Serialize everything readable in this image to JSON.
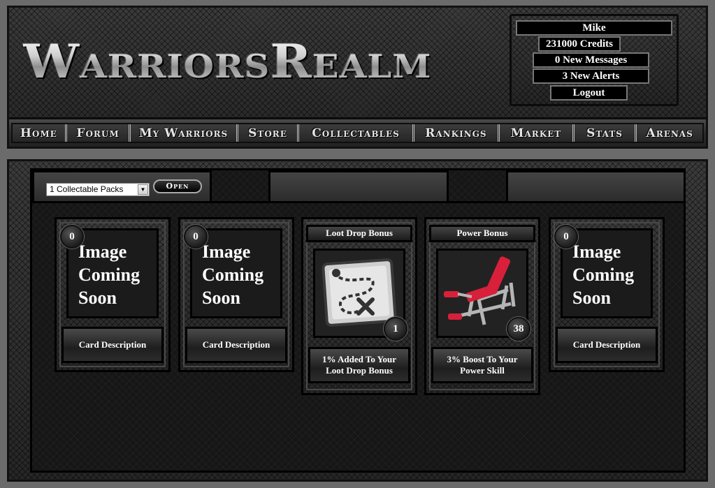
{
  "header": {
    "logo_text": "WarriorsRealm",
    "user": {
      "name": "Mike",
      "credits": "231000 Credits",
      "messages": "0 New Messages",
      "alerts": "3 New Alerts",
      "logout": "Logout"
    },
    "nav": [
      "Home",
      "Forum",
      "My Warriors",
      "Store",
      "Collectables",
      "Rankings",
      "Market",
      "Stats",
      "Arenas"
    ]
  },
  "controls": {
    "pack_select_value": "1 Collectable Packs",
    "open_label": "Open"
  },
  "cards": [
    {
      "count": "0",
      "image_text": [
        "Image",
        "Coming",
        "Soon"
      ],
      "description": "Card Description"
    },
    {
      "count": "0",
      "image_text": [
        "Image",
        "Coming",
        "Soon"
      ],
      "description": "Card Description"
    },
    {
      "title": "Loot Drop Bonus",
      "count": "1",
      "icon": "treasure-map-icon",
      "description": "1% Added To Your Loot Drop Bonus"
    },
    {
      "title": "Power Bonus",
      "count": "38",
      "icon": "weight-bench-icon",
      "description": "3% Boost To Your Power Skill"
    },
    {
      "count": "0",
      "image_text": [
        "Image",
        "Coming",
        "Soon"
      ],
      "description": "Card Description"
    }
  ],
  "colors": {
    "bench_red": "#d8203a",
    "bench_frame": "#b5b5b5"
  }
}
